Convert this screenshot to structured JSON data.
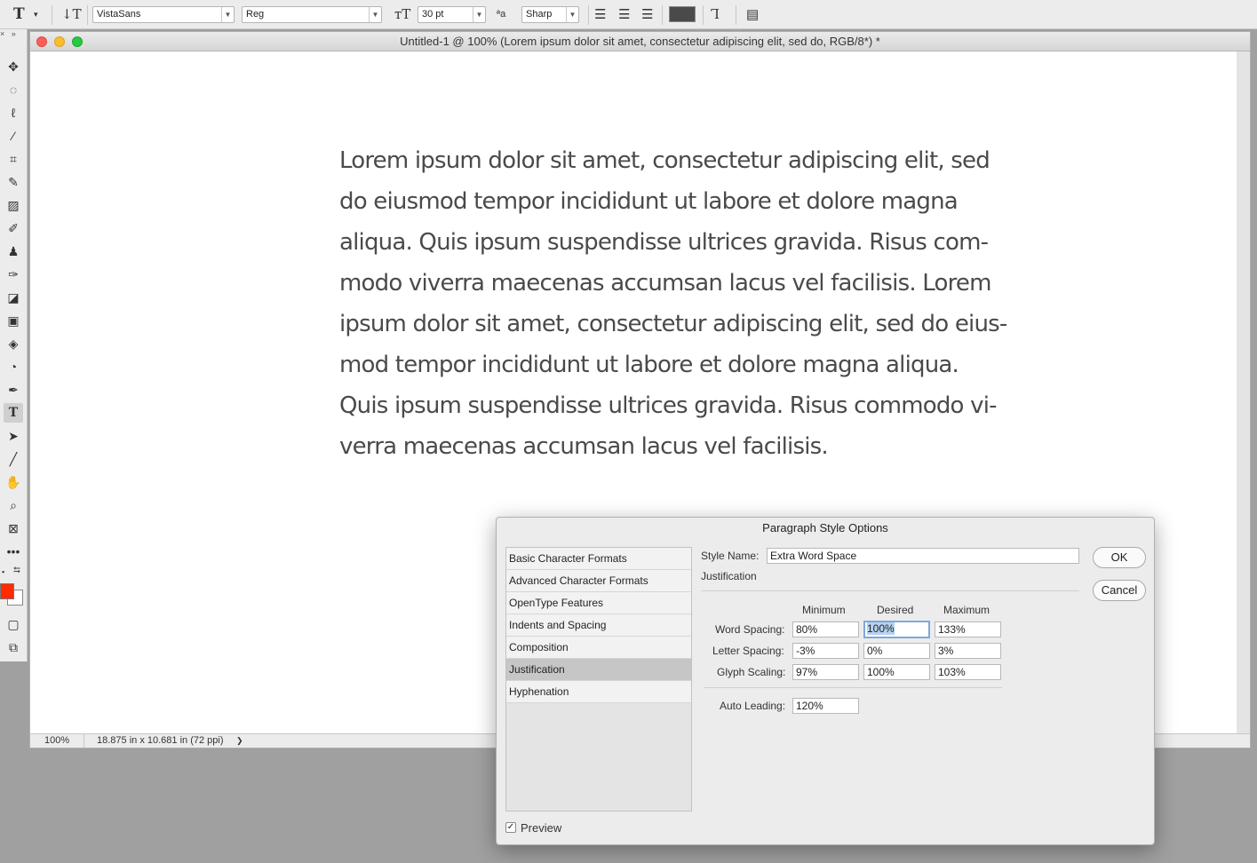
{
  "options_bar": {
    "font_family": "VistaSans",
    "font_style": "Reg",
    "font_size": "30 pt",
    "antialias": "Sharp",
    "text_color": "#4a4a4a"
  },
  "document": {
    "title": "Untitled-1 @ 100% (Lorem ipsum dolor sit amet, consectetur adipiscing elit, sed do, RGB/8*) *",
    "text_lines": [
      "Lorem ipsum dolor sit amet, consectetur adipiscing elit, sed",
      "do eiusmod tempor incididunt ut labore et dolore magna",
      "aliqua. Quis ipsum suspendisse ultrices gravida. Risus com-",
      "modo viverra maecenas accumsan lacus vel facilisis. Lorem",
      "ipsum dolor sit amet, consectetur adipiscing elit, sed do eius-",
      "mod tempor incididunt ut labore et dolore magna aliqua.",
      "Quis ipsum suspendisse ultrices gravida. Risus commodo vi-",
      "verra maecenas accumsan lacus vel facilisis."
    ],
    "zoom": "100%",
    "doc_size": "18.875 in x 10.681 in (72 ppi)",
    "status_arrow": "❯"
  },
  "tools": {
    "foreground_color": "#ff2a00",
    "background_color": "#ffffff"
  },
  "dialog": {
    "title": "Paragraph Style Options",
    "categories": [
      "Basic Character Formats",
      "Advanced Character Formats",
      "OpenType Features",
      "Indents and Spacing",
      "Composition",
      "Justification",
      "Hyphenation"
    ],
    "selected_category": "Justification",
    "style_name_label": "Style Name:",
    "style_name": "Extra Word Space",
    "section": "Justification",
    "col_headers": [
      "Minimum",
      "Desired",
      "Maximum"
    ],
    "rows": [
      {
        "label": "Word Spacing:",
        "values": [
          "80%",
          "100%",
          "133%"
        ]
      },
      {
        "label": "Letter Spacing:",
        "values": [
          "-3%",
          "0%",
          "3%"
        ]
      },
      {
        "label": "Glyph Scaling:",
        "values": [
          "97%",
          "100%",
          "103%"
        ]
      }
    ],
    "auto_leading_label": "Auto Leading:",
    "auto_leading": "120%",
    "ok_label": "OK",
    "cancel_label": "Cancel",
    "preview_label": "Preview",
    "preview_checked": true
  }
}
